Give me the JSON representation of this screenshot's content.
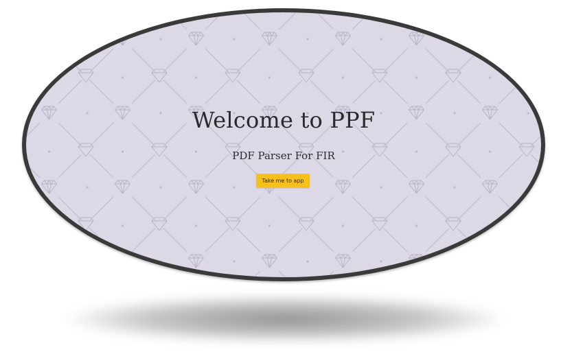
{
  "hero": {
    "title": "Welcome to PPF",
    "subtitle": "PDF Parser For FIR",
    "cta_label": "Take me to app"
  },
  "theme": {
    "background": "#dcd8e6",
    "pattern_color": "#b9b3c8",
    "frame_color": "#3a3a3a",
    "cta_color": "#f7c01a",
    "pattern_icon": "diamond-icon"
  }
}
